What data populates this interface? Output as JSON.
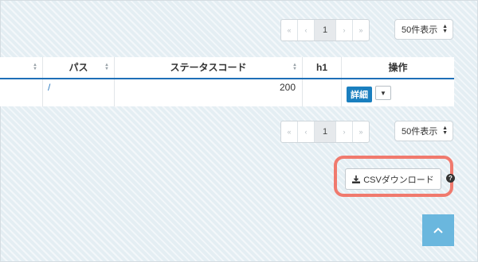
{
  "pagination": {
    "first": "«",
    "prev": "‹",
    "current": "1",
    "next": "›",
    "last": "»"
  },
  "per_page": {
    "selected": "50件表示"
  },
  "table": {
    "headers": [
      "パス",
      "ステータスコード",
      "h1",
      "操作"
    ],
    "rows": [
      {
        "path": "/",
        "status_code": "200",
        "h1": "",
        "detail_label": "詳細"
      }
    ]
  },
  "csv": {
    "download_label": "CSVダウンロード",
    "help_glyph": "?"
  },
  "colors": {
    "accent": "#1e6fb8",
    "highlight": "#f07a6e",
    "back_to_top": "#6ab7de"
  },
  "icons": [
    "download-icon",
    "question-circle-icon",
    "chevron-up-icon",
    "caret-down-icon"
  ]
}
